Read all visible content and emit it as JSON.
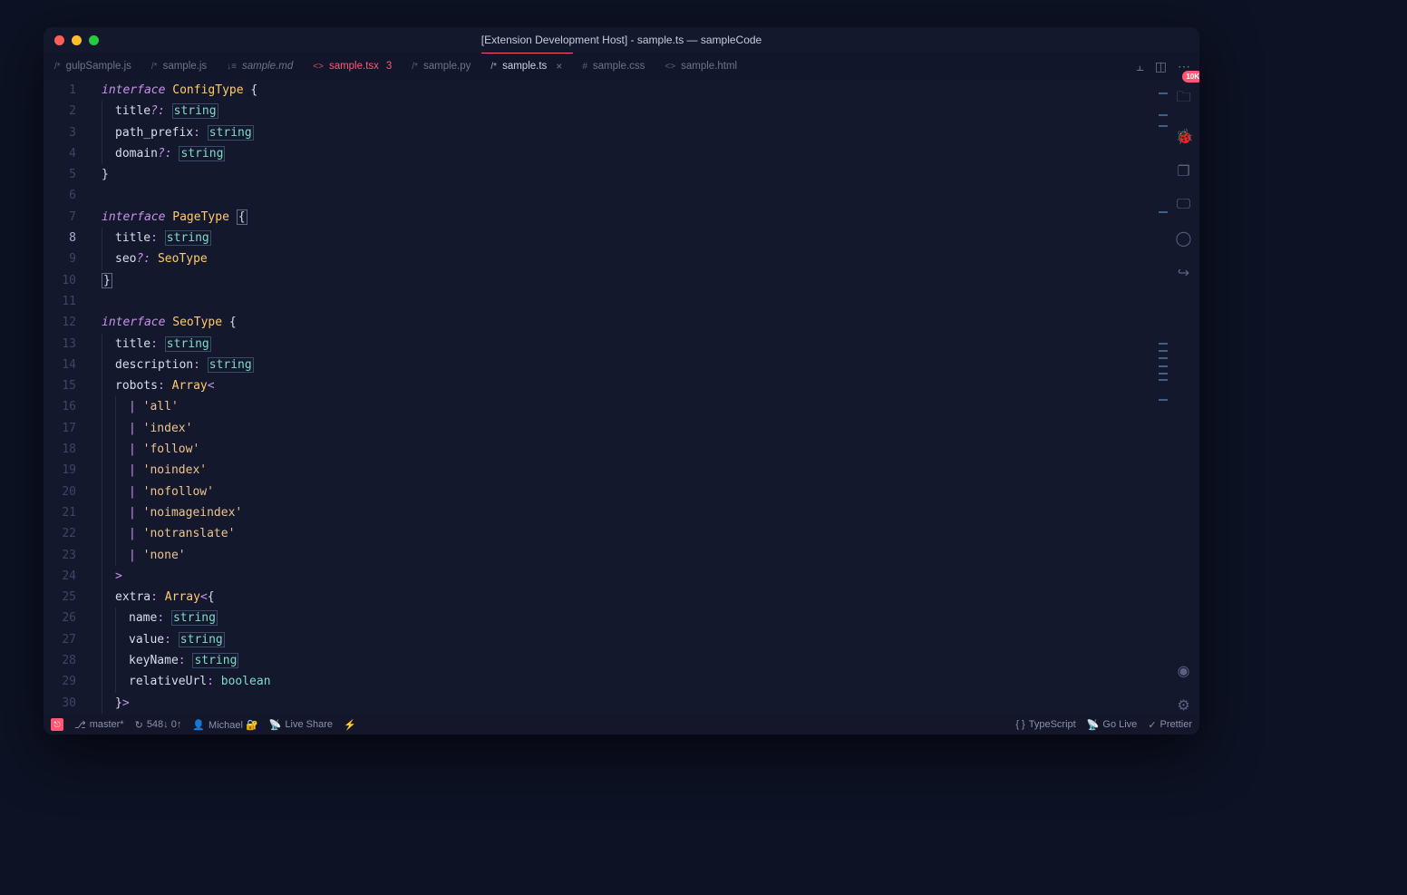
{
  "titlebar": {
    "title": "[Extension Development Host] - sample.ts — sampleCode"
  },
  "tabs": [
    {
      "icon": "/*",
      "label": "gulpSample.js",
      "kind": ""
    },
    {
      "icon": "/*",
      "label": "sample.js",
      "kind": ""
    },
    {
      "icon": "↓≡",
      "label": "sample.md",
      "kind": "md"
    },
    {
      "icon": "<>",
      "label": "sample.tsx",
      "kind": "tsx",
      "suffix": "3"
    },
    {
      "icon": "/*",
      "label": "sample.py",
      "kind": ""
    },
    {
      "icon": "/*",
      "label": "sample.ts",
      "kind": "active",
      "closable": true
    },
    {
      "icon": "#",
      "label": "sample.css",
      "kind": ""
    },
    {
      "icon": "<>",
      "label": "sample.html",
      "kind": ""
    }
  ],
  "badge": "10K",
  "code_lines": [
    [
      [
        "kw",
        "interface"
      ],
      [
        "sp",
        " "
      ],
      [
        "typename",
        "ConfigType"
      ],
      [
        "sp",
        " "
      ],
      [
        "brace",
        "{"
      ]
    ],
    [
      [
        "ind"
      ],
      [
        "prop",
        "title"
      ],
      [
        "punct",
        "?:"
      ],
      [
        "sp",
        " "
      ],
      [
        "prim",
        "string"
      ]
    ],
    [
      [
        "ind"
      ],
      [
        "prop",
        "path_prefix"
      ],
      [
        "colon",
        ":"
      ],
      [
        "sp",
        " "
      ],
      [
        "prim",
        "string"
      ]
    ],
    [
      [
        "ind"
      ],
      [
        "prop",
        "domain"
      ],
      [
        "punct",
        "?:"
      ],
      [
        "sp",
        " "
      ],
      [
        "prim",
        "string"
      ]
    ],
    [
      [
        "brace",
        "}"
      ]
    ],
    [],
    [
      [
        "kw",
        "interface"
      ],
      [
        "sp",
        " "
      ],
      [
        "typename",
        "PageType"
      ],
      [
        "sp",
        " "
      ],
      [
        "brace-hl",
        "{"
      ]
    ],
    [
      [
        "ind"
      ],
      [
        "prop",
        "title"
      ],
      [
        "colon",
        ":"
      ],
      [
        "sp",
        " "
      ],
      [
        "prim",
        "string"
      ]
    ],
    [
      [
        "ind"
      ],
      [
        "prop",
        "seo"
      ],
      [
        "punct",
        "?:"
      ],
      [
        "sp",
        " "
      ],
      [
        "typename",
        "SeoType"
      ]
    ],
    [
      [
        "brace-hl",
        "}"
      ]
    ],
    [],
    [
      [
        "kw",
        "interface"
      ],
      [
        "sp",
        " "
      ],
      [
        "typename",
        "SeoType"
      ],
      [
        "sp",
        " "
      ],
      [
        "brace",
        "{"
      ]
    ],
    [
      [
        "ind"
      ],
      [
        "prop",
        "title"
      ],
      [
        "colon",
        ":"
      ],
      [
        "sp",
        " "
      ],
      [
        "prim",
        "string"
      ]
    ],
    [
      [
        "ind"
      ],
      [
        "prop",
        "description"
      ],
      [
        "colon",
        ":"
      ],
      [
        "sp",
        " "
      ],
      [
        "prim",
        "string"
      ]
    ],
    [
      [
        "ind"
      ],
      [
        "prop",
        "robots"
      ],
      [
        "colon",
        ":"
      ],
      [
        "sp",
        " "
      ],
      [
        "typename",
        "Array"
      ],
      [
        "angle",
        "<"
      ]
    ],
    [
      [
        "ind2"
      ],
      [
        "pipe",
        "|"
      ],
      [
        "sp",
        " "
      ],
      [
        "str",
        "'all'"
      ]
    ],
    [
      [
        "ind2"
      ],
      [
        "pipe",
        "|"
      ],
      [
        "sp",
        " "
      ],
      [
        "str",
        "'index'"
      ]
    ],
    [
      [
        "ind2"
      ],
      [
        "pipe",
        "|"
      ],
      [
        "sp",
        " "
      ],
      [
        "str",
        "'follow'"
      ]
    ],
    [
      [
        "ind2"
      ],
      [
        "pipe",
        "|"
      ],
      [
        "sp",
        " "
      ],
      [
        "str",
        "'noindex'"
      ]
    ],
    [
      [
        "ind2"
      ],
      [
        "pipe",
        "|"
      ],
      [
        "sp",
        " "
      ],
      [
        "str",
        "'nofollow'"
      ]
    ],
    [
      [
        "ind2"
      ],
      [
        "pipe",
        "|"
      ],
      [
        "sp",
        " "
      ],
      [
        "str",
        "'noimageindex'"
      ]
    ],
    [
      [
        "ind2"
      ],
      [
        "pipe",
        "|"
      ],
      [
        "sp",
        " "
      ],
      [
        "str",
        "'notranslate'"
      ]
    ],
    [
      [
        "ind2"
      ],
      [
        "pipe",
        "|"
      ],
      [
        "sp",
        " "
      ],
      [
        "str",
        "'none'"
      ]
    ],
    [
      [
        "ind"
      ],
      [
        "angle",
        ">"
      ]
    ],
    [
      [
        "ind"
      ],
      [
        "prop",
        "extra"
      ],
      [
        "colon",
        ":"
      ],
      [
        "sp",
        " "
      ],
      [
        "typename",
        "Array"
      ],
      [
        "angle",
        "<"
      ],
      [
        "brace",
        "{"
      ]
    ],
    [
      [
        "ind2"
      ],
      [
        "prop",
        "name"
      ],
      [
        "colon",
        ":"
      ],
      [
        "sp",
        " "
      ],
      [
        "prim",
        "string"
      ]
    ],
    [
      [
        "ind2"
      ],
      [
        "prop",
        "value"
      ],
      [
        "colon",
        ":"
      ],
      [
        "sp",
        " "
      ],
      [
        "prim",
        "string"
      ]
    ],
    [
      [
        "ind2"
      ],
      [
        "prop",
        "keyName"
      ],
      [
        "colon",
        ":"
      ],
      [
        "sp",
        " "
      ],
      [
        "prim",
        "string"
      ]
    ],
    [
      [
        "ind2"
      ],
      [
        "prop",
        "relativeUrl"
      ],
      [
        "colon",
        ":"
      ],
      [
        "sp",
        " "
      ],
      [
        "primnobox",
        "boolean"
      ]
    ],
    [
      [
        "ind"
      ],
      [
        "brace",
        "}"
      ],
      [
        "angle",
        ">"
      ]
    ],
    [
      [
        "brace",
        "}"
      ]
    ]
  ],
  "active_line": 8,
  "side_icons": [
    "folder-icon",
    "bug-icon",
    "layers-icon",
    "desktop-icon",
    "github-icon",
    "share-icon"
  ],
  "side_bottom": [
    "account-icon",
    "settings-icon"
  ],
  "statusbar": {
    "left": [
      {
        "icon": "⎇",
        "text": "master*"
      },
      {
        "icon": "↻",
        "text": "548↓ 0↑"
      },
      {
        "icon": "👤",
        "text": "Michael 🔐"
      },
      {
        "icon": "📡",
        "text": "Live Share"
      },
      {
        "icon": "⚡",
        "text": ""
      }
    ],
    "right": [
      {
        "icon": "{ }",
        "text": "TypeScript"
      },
      {
        "icon": "📡",
        "text": "Go Live"
      },
      {
        "icon": "✓",
        "text": "Prettier"
      }
    ]
  }
}
